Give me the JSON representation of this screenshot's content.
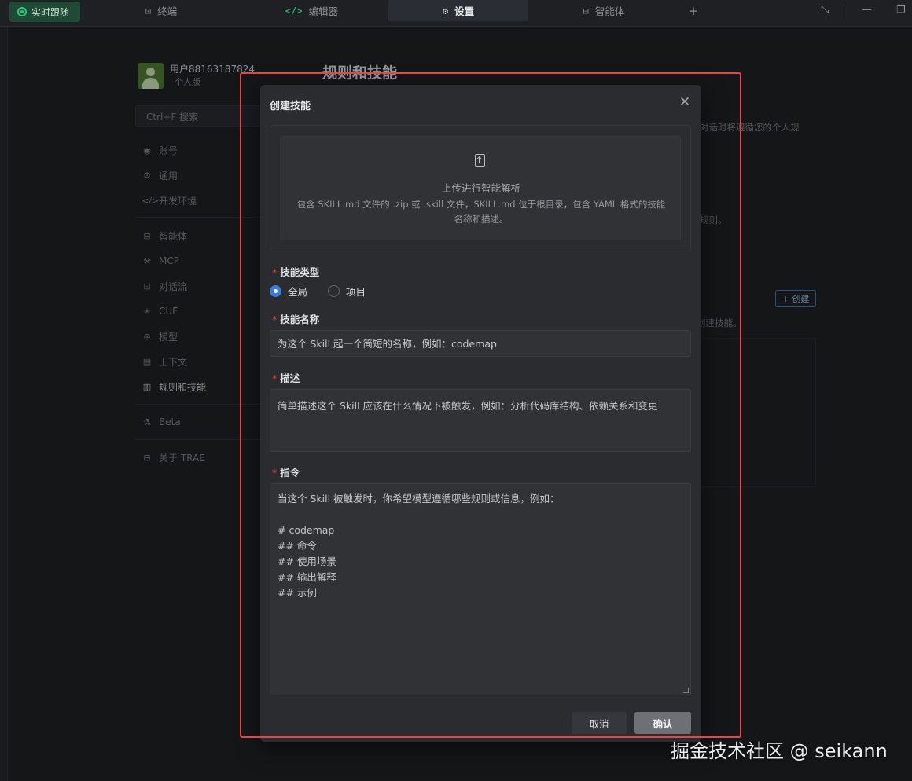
{
  "topbar": {
    "live_label": "实时跟随",
    "tabs": [
      {
        "label": "终端",
        "icon": "terminal-icon"
      },
      {
        "label": "编辑器",
        "icon": "code-icon"
      },
      {
        "label": "设置",
        "icon": "gear-icon"
      },
      {
        "label": "智能体",
        "icon": "agent-icon"
      }
    ],
    "add_tab": "+",
    "active_tab": "设置"
  },
  "sidebar": {
    "user_name": "用户88163187824",
    "plan": "个人版",
    "search_placeholder": "Ctrl+F 搜索",
    "items": [
      {
        "label": "账号",
        "icon": "user-icon"
      },
      {
        "label": "通用",
        "icon": "gear-icon"
      },
      {
        "label": "开发环境",
        "icon": "code-icon"
      },
      {
        "label": "智能体",
        "icon": "agent-icon"
      },
      {
        "label": "MCP",
        "icon": "wrench-icon"
      },
      {
        "label": "对话流",
        "icon": "chat-icon"
      },
      {
        "label": "CUE",
        "icon": "cue-icon"
      },
      {
        "label": "模型",
        "icon": "model-icon"
      },
      {
        "label": "上下文",
        "icon": "context-icon"
      },
      {
        "label": "规则和技能",
        "icon": "book-icon"
      },
      {
        "label": "Beta",
        "icon": "flask-icon"
      },
      {
        "label": "关于 TRAE",
        "icon": "info-icon"
      }
    ],
    "active_item": "规则和技能"
  },
  "page": {
    "title": "规则和技能",
    "bg_snippet_1": "对话时将遵循您的个人规",
    "bg_snippet_2": "规则。",
    "bg_snippet_3": "创建技能。",
    "create_button": "+ 创建"
  },
  "modal": {
    "title": "创建技能",
    "upload_title": "上传进行智能解析",
    "upload_desc": "包含 SKILL.md 文件的 .zip 或 .skill 文件，SKILL.md 位于根目录，包含 YAML 格式的技能名称和描述。",
    "skill_type_label": "技能类型",
    "skill_type_options": [
      "全局",
      "项目"
    ],
    "skill_type_selected": "全局",
    "name_label": "技能名称",
    "name_placeholder": "为这个 Skill 起一个简短的名称，例如：codemap",
    "desc_label": "描述",
    "desc_placeholder": "简单描述这个 Skill 应该在什么情况下被触发，例如：分析代码库结构、依赖关系和变更",
    "instructions_label": "指令",
    "instructions_placeholder": "当这个 Skill 被触发时，你希望模型遵循哪些规则或信息，例如：\n\n# codemap\n## 命令\n## 使用场景\n## 输出解释\n## 示例",
    "cancel_label": "取消",
    "confirm_label": "确认"
  },
  "watermark": "掘金技术社区 @ seikann",
  "colors": {
    "accent_blue": "#3d7bdb",
    "required_red": "#e0493c",
    "highlight_red": "#e2474d",
    "live_green": "#36c57f"
  }
}
